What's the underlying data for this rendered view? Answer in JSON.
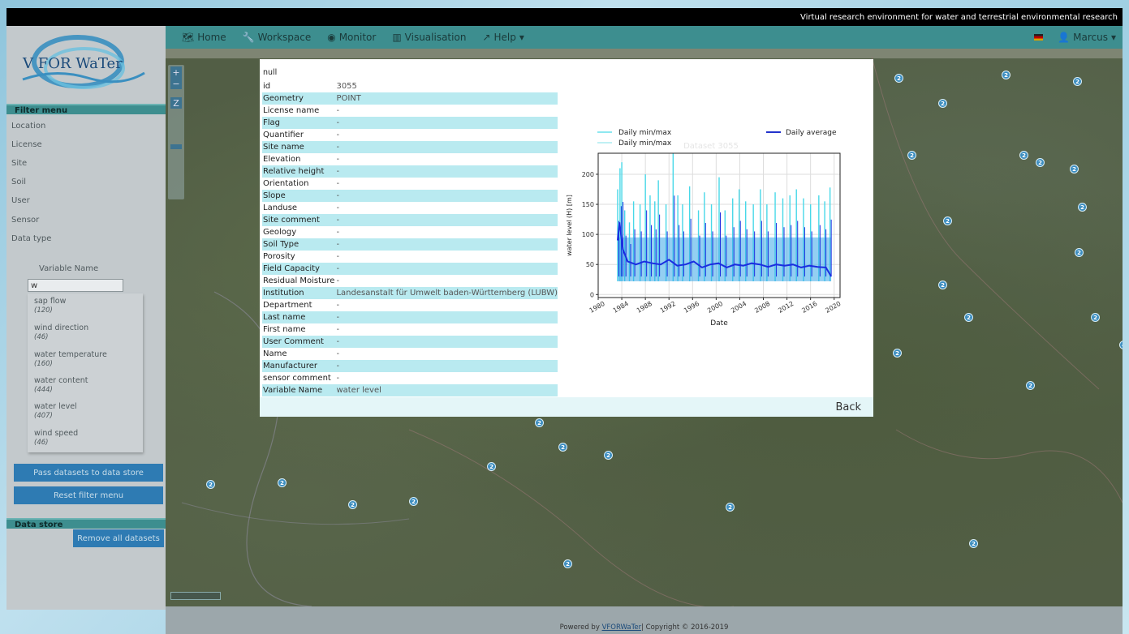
{
  "topbar": {
    "tagline": "Virtual research environment for water and terrestrial environmental research"
  },
  "logo": {
    "text": "V FOR WaTer"
  },
  "nav": {
    "items": [
      {
        "label": "Home",
        "icon": "map-icon"
      },
      {
        "label": "Workspace",
        "icon": "wrench-icon"
      },
      {
        "label": "Monitor",
        "icon": "eye-icon"
      },
      {
        "label": "Visualisation",
        "icon": "bar-chart-icon"
      },
      {
        "label": "Help",
        "icon": "external-link-icon"
      }
    ],
    "user": "Marcus"
  },
  "filter_menu": {
    "title": "Filter menu",
    "items": [
      "Location",
      "License",
      "Site",
      "Soil",
      "User",
      "Sensor",
      "Data type"
    ],
    "variable_name_label": "Variable Name",
    "variable_input_value": "w",
    "variables": [
      {
        "name": "sap flow",
        "count": "(120)"
      },
      {
        "name": "wind direction",
        "count": "(46)"
      },
      {
        "name": "water temperature",
        "count": "(160)"
      },
      {
        "name": "water content",
        "count": "(444)"
      },
      {
        "name": "water level",
        "count": "(407)"
      },
      {
        "name": "wind speed",
        "count": "(46)"
      }
    ],
    "pass_button": "Pass datasets to data store",
    "reset_button": "Reset filter menu"
  },
  "data_store": {
    "title": "Data store",
    "remove_button": "Remove all datasets"
  },
  "modal": {
    "null_text": "null",
    "rows": [
      {
        "key": "id",
        "value": "3055"
      },
      {
        "key": "Geometry",
        "value": "POINT"
      },
      {
        "key": "License name",
        "value": "-"
      },
      {
        "key": "Flag",
        "value": "-"
      },
      {
        "key": "Quantifier",
        "value": "-"
      },
      {
        "key": "Site name",
        "value": "-"
      },
      {
        "key": "Elevation",
        "value": "-"
      },
      {
        "key": "Relative height",
        "value": "-"
      },
      {
        "key": "Orientation",
        "value": "-"
      },
      {
        "key": "Slope",
        "value": "-"
      },
      {
        "key": "Landuse",
        "value": "-"
      },
      {
        "key": "Site comment",
        "value": "-"
      },
      {
        "key": "Geology",
        "value": "-"
      },
      {
        "key": "Soil Type",
        "value": "-"
      },
      {
        "key": "Porosity",
        "value": "-"
      },
      {
        "key": "Field Capacity",
        "value": "-"
      },
      {
        "key": "Residual Moisture",
        "value": "-"
      },
      {
        "key": "Institution",
        "value": "Landesanstalt für Umwelt baden-Württemberg (LUBW)"
      },
      {
        "key": "Department",
        "value": "-"
      },
      {
        "key": "Last name",
        "value": "-"
      },
      {
        "key": "First name",
        "value": "-"
      },
      {
        "key": "User Comment",
        "value": "-"
      },
      {
        "key": "Name",
        "value": "-"
      },
      {
        "key": "Manufacturer",
        "value": "-"
      },
      {
        "key": "sensor comment",
        "value": "-"
      },
      {
        "key": "Variable Name",
        "value": "water level"
      }
    ],
    "back_label": "Back"
  },
  "chart_data": {
    "type": "line",
    "title": "Dataset 3055",
    "xlabel": "Date",
    "ylabel": "water level (H) [m]",
    "xlim": [
      1980,
      2021
    ],
    "ylim": [
      -5,
      235
    ],
    "x_ticks": [
      "1980",
      "1984",
      "1988",
      "1992",
      "1996",
      "2000",
      "2004",
      "2008",
      "2012",
      "2016",
      "2020"
    ],
    "y_ticks": [
      0,
      50,
      100,
      150,
      200
    ],
    "grid": true,
    "legend": [
      {
        "label": "Daily min/max",
        "color": "#8ee8f0"
      },
      {
        "label": "Daily min/max",
        "color": "#bff0f4"
      },
      {
        "label": "Daily average",
        "color": "#2233cc"
      }
    ],
    "legend_placement": "top",
    "series": [
      {
        "name": "Daily min/max",
        "x": [
          1983.3,
          1983.7,
          1984.0,
          1984.5,
          1985.3,
          1986.0,
          1987.1,
          1988.0,
          1988.8,
          1989.6,
          1990.2,
          1991.5,
          1992.7,
          1993.5,
          1994.3,
          1995.5,
          1997.0,
          1998.0,
          1999.2,
          2000.5,
          2001.5,
          2002.8,
          2003.9,
          2005.0,
          2006.3,
          2007.5,
          2008.6,
          2010.0,
          2011.3,
          2012.5,
          2013.6,
          2014.8,
          2016.0,
          2017.4,
          2018.4,
          2019.3
        ],
        "y": [
          175,
          210,
          220,
          140,
          120,
          155,
          150,
          200,
          165,
          155,
          190,
          150,
          235,
          165,
          150,
          180,
          140,
          170,
          150,
          195,
          140,
          160,
          175,
          155,
          150,
          175,
          150,
          170,
          160,
          165,
          175,
          160,
          150,
          165,
          155,
          178
        ]
      },
      {
        "name": "Daily average",
        "x": [
          1983.3,
          1983.6,
          1984.2,
          1985.0,
          1986.4,
          1987.8,
          1989.2,
          1990.6,
          1992.0,
          1993.4,
          1994.8,
          1996.2,
          1997.6,
          1999.0,
          2000.4,
          2001.8,
          2003.2,
          2004.6,
          2006.0,
          2007.4,
          2008.8,
          2010.2,
          2011.6,
          2013.0,
          2014.4,
          2015.8,
          2017.2,
          2018.6,
          2019.5
        ],
        "y": [
          90,
          120,
          75,
          55,
          50,
          55,
          52,
          50,
          58,
          48,
          50,
          55,
          45,
          50,
          52,
          45,
          50,
          48,
          52,
          50,
          46,
          50,
          48,
          50,
          45,
          48,
          46,
          45,
          30
        ]
      }
    ]
  },
  "map": {
    "markers": [
      "2",
      "2",
      "2",
      "2",
      "2",
      "2",
      "2",
      "2",
      "2",
      "2",
      "2",
      "2",
      "2",
      "2",
      "2",
      "4",
      "2",
      "2",
      "2",
      "2",
      "2",
      "2",
      "2",
      "2",
      "2",
      "2",
      "2",
      "2"
    ],
    "zoom_in": "+",
    "zoom_out": "−",
    "zoom_box": "Z"
  },
  "footer": {
    "prefix": "Powered by ",
    "link": "VFORWaTer",
    "suffix": " | Copyright © 2016-2019"
  }
}
